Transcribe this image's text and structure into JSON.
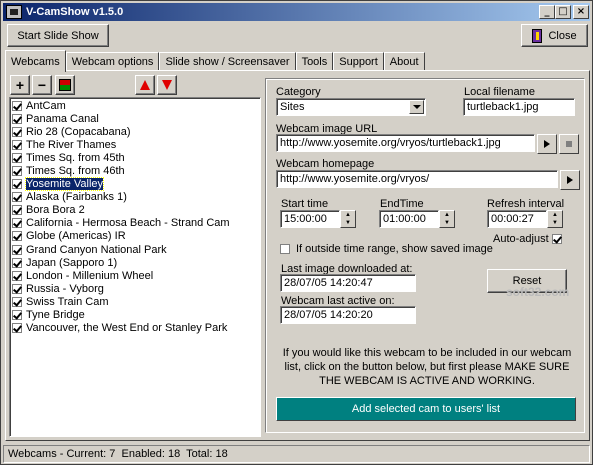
{
  "window": {
    "title": "V-CamShow v1.5.0"
  },
  "toolbar": {
    "start_slide_show": "Start Slide Show",
    "close": "Close"
  },
  "tabs": [
    "Webcams",
    "Webcam options",
    "Slide show / Screensaver",
    "Tools",
    "Support",
    "About"
  ],
  "webcams": [
    {
      "name": "AntCam",
      "checked": true
    },
    {
      "name": "Panama Canal",
      "checked": true
    },
    {
      "name": "Rio 28 (Copacabana)",
      "checked": true
    },
    {
      "name": "The River Thames",
      "checked": true
    },
    {
      "name": "Times Sq. from 45th",
      "checked": true
    },
    {
      "name": "Times Sq. from 46th",
      "checked": true
    },
    {
      "name": "Yosemite Valley",
      "checked": true,
      "selected": true
    },
    {
      "name": "Alaska (Fairbanks 1)",
      "checked": true
    },
    {
      "name": "Bora Bora 2",
      "checked": true
    },
    {
      "name": "California - Hermosa Beach - Strand Cam",
      "checked": true
    },
    {
      "name": "Globe (Americas) IR",
      "checked": true
    },
    {
      "name": "Grand Canyon National Park",
      "checked": true
    },
    {
      "name": "Japan (Sapporo 1)",
      "checked": true
    },
    {
      "name": "London - Millenium Wheel",
      "checked": true
    },
    {
      "name": "Russia - Vyborg",
      "checked": true
    },
    {
      "name": "Swiss Train Cam",
      "checked": true
    },
    {
      "name": "Tyne Bridge",
      "checked": true
    },
    {
      "name": "Vancouver, the West End or Stanley Park",
      "checked": true
    }
  ],
  "details": {
    "category_label": "Category",
    "category_value": "Sites",
    "local_filename_label": "Local filename",
    "local_filename_value": "turtleback1.jpg",
    "image_url_label": "Webcam image URL",
    "image_url_value": "http://www.yosemite.org/vryos/turtleback1.jpg",
    "homepage_label": "Webcam homepage",
    "homepage_value": "http://www.yosemite.org/vryos/",
    "start_time_label": "Start time",
    "start_time_value": "15:00:00",
    "end_time_label": "EndTime",
    "end_time_value": "01:00:00",
    "refresh_label": "Refresh interval",
    "refresh_value": "00:00:27",
    "auto_adjust_label": "Auto-adjust",
    "auto_adjust_checked": true,
    "outside_range_label": "If outside time range, show saved image",
    "outside_range_checked": false,
    "last_download_label": "Last image downloaded at:",
    "last_download_value": "28/07/05 14:20:47",
    "reset_label": "Reset",
    "last_active_label": "Webcam last active on:",
    "last_active_value": "28/07/05 14:20:20",
    "note": "If you would like this webcam to be included in our webcam list, click on the button below, but first please MAKE SURE THE WEBCAM IS ACTIVE AND WORKING.",
    "add_button": "Add selected cam to users' list"
  },
  "watermark": "soft32.com",
  "status": {
    "text": "Webcams - Current: 7  Enabled: 18  Total: 18"
  },
  "colors": {
    "title_start": "#0a246a",
    "title_end": "#a6caf0",
    "selection": "#0a246a",
    "add_button": "#008080",
    "arrow_red": "#e00000"
  }
}
